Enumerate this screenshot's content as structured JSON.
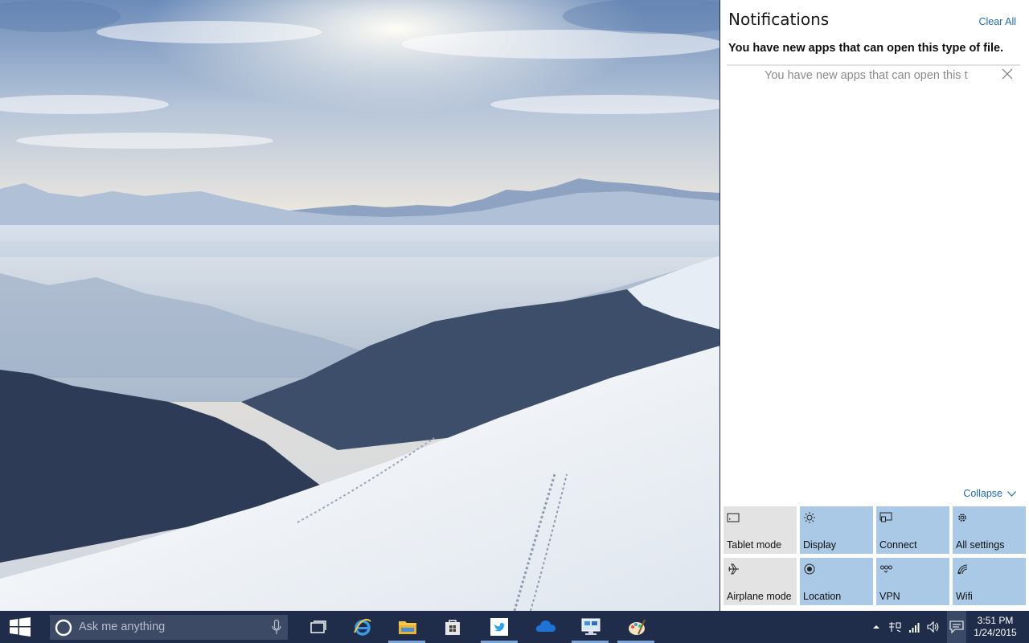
{
  "action_center": {
    "title": "Notifications",
    "clear_all": "Clear All",
    "notification_group_header": "You have new apps that can open this type of file.",
    "notification_text": "You have new apps that can open this t",
    "collapse_label": "Collapse",
    "quick_actions": [
      {
        "label": "Tablet mode",
        "icon": "tablet-icon",
        "state": "off"
      },
      {
        "label": "Display",
        "icon": "brightness-icon",
        "state": "on"
      },
      {
        "label": "Connect",
        "icon": "connect-icon",
        "state": "on"
      },
      {
        "label": "All settings",
        "icon": "gear-icon",
        "state": "on"
      },
      {
        "label": "Airplane mode",
        "icon": "airplane-icon",
        "state": "off"
      },
      {
        "label": "Location",
        "icon": "location-icon",
        "state": "on"
      },
      {
        "label": "VPN",
        "icon": "vpn-icon",
        "state": "on"
      },
      {
        "label": "Wifi",
        "icon": "wifi-icon",
        "state": "on"
      }
    ]
  },
  "taskbar": {
    "search_placeholder": "Ask me anything",
    "apps": [
      {
        "name": "task-view",
        "icon": "task-view-icon",
        "active": false
      },
      {
        "name": "internet-explorer",
        "icon": "internet-explorer-icon",
        "active": false
      },
      {
        "name": "file-explorer",
        "icon": "folder-icon",
        "active": true
      },
      {
        "name": "store",
        "icon": "store-icon",
        "active": false
      },
      {
        "name": "twitter",
        "icon": "twitter-icon",
        "active": true
      },
      {
        "name": "onedrive",
        "icon": "cloud-icon",
        "active": false
      },
      {
        "name": "remote-desktop",
        "icon": "remote-desktop-icon",
        "active": true
      },
      {
        "name": "paint",
        "icon": "paint-icon",
        "active": true
      }
    ],
    "tray_icons": [
      "chevron-up-icon",
      "input-method-icon",
      "network-bars-icon",
      "volume-icon",
      "action-center-icon"
    ],
    "time": "3:51 PM",
    "date": "1/24/2015"
  },
  "colors": {
    "accent": "#1a6bb3",
    "tile_on": "#a9c9e6",
    "tile_off": "#e3e3e3",
    "taskbar": "#1f2d4b"
  }
}
